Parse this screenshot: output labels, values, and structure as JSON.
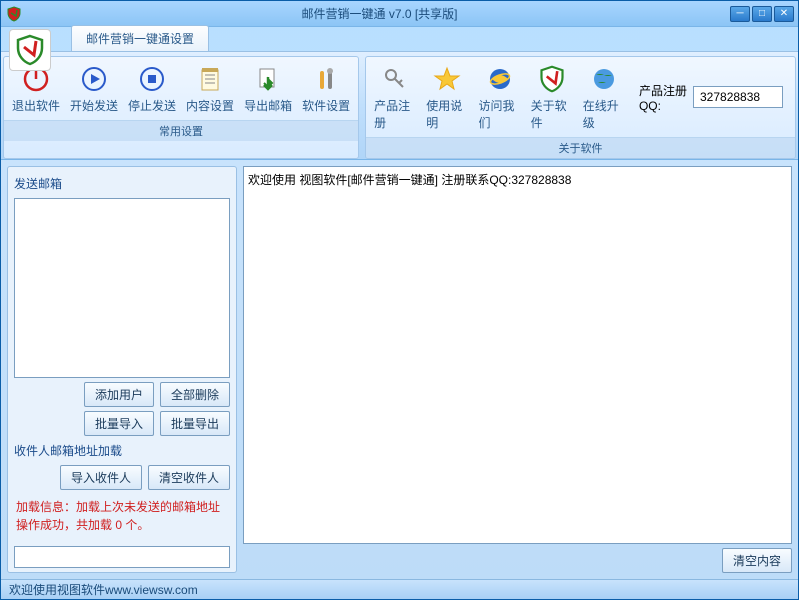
{
  "title": "邮件营销一键通 v7.0 [共享版]",
  "tab": "邮件营销一键通设置",
  "toolbar": {
    "group1": {
      "exit": "退出软件",
      "start": "开始发送",
      "stop": "停止发送",
      "content": "内容设置",
      "export": "导出邮箱",
      "settings": "软件设置",
      "title": "常用设置"
    },
    "group2": {
      "register": "产品注册",
      "manual": "使用说明",
      "visit": "访问我们",
      "about": "关于软件",
      "upgrade": "在线升级",
      "qq_label": "产品注册QQ:",
      "qq_value": "327828838",
      "title": "关于软件"
    }
  },
  "left": {
    "send_mailbox": "发送邮箱",
    "add_user": "添加用户",
    "delete_all": "全部删除",
    "batch_import": "批量导入",
    "batch_export": "批量导出",
    "recipient_header": "收件人邮箱地址加载",
    "import_recipient": "导入收件人",
    "clear_recipient": "清空收件人",
    "load_info": "加载信息：加载上次未发送的邮箱地址操作成功，共加载 0 个。"
  },
  "right": {
    "welcome": "欢迎使用  视图软件[邮件营销一键通]  注册联系QQ:327828838",
    "clear": "清空内容"
  },
  "status": {
    "text": "欢迎使用视图软件 ",
    "url": "www.viewsw.com"
  }
}
